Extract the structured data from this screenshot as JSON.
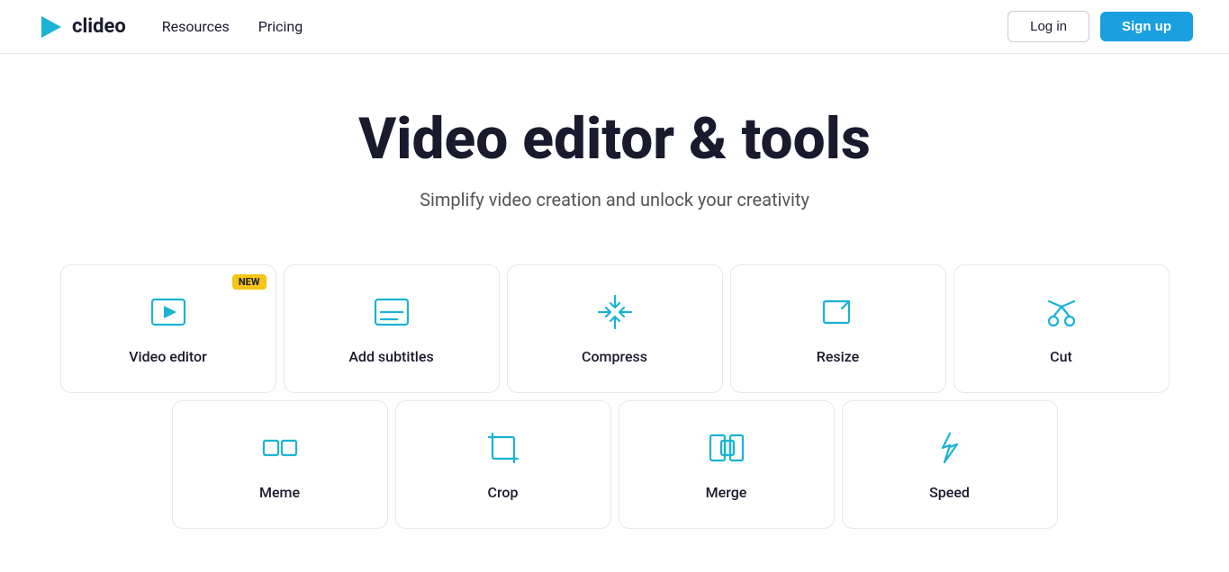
{
  "nav": {
    "logo_text": "clideo",
    "links": [
      {
        "label": "Resources",
        "id": "resources"
      },
      {
        "label": "Pricing",
        "id": "pricing"
      }
    ],
    "login_label": "Log in",
    "signup_label": "Sign up"
  },
  "hero": {
    "title": "Video editor & tools",
    "subtitle": "Simplify video creation and unlock your creativity"
  },
  "tools_row1": [
    {
      "id": "video-editor",
      "label": "Video editor",
      "icon": "video-editor-icon",
      "new": true
    },
    {
      "id": "add-subtitles",
      "label": "Add subtitles",
      "icon": "subtitles-icon",
      "new": false
    },
    {
      "id": "compress",
      "label": "Compress",
      "icon": "compress-icon",
      "new": false
    },
    {
      "id": "resize",
      "label": "Resize",
      "icon": "resize-icon",
      "new": false
    },
    {
      "id": "cut",
      "label": "Cut",
      "icon": "cut-icon",
      "new": false
    }
  ],
  "tools_row2": [
    {
      "id": "meme",
      "label": "Meme",
      "icon": "meme-icon",
      "new": false
    },
    {
      "id": "crop",
      "label": "Crop",
      "icon": "crop-icon",
      "new": false
    },
    {
      "id": "merge",
      "label": "Merge",
      "icon": "merge-icon",
      "new": false
    },
    {
      "id": "speed",
      "label": "Speed",
      "icon": "speed-icon",
      "new": false
    }
  ],
  "colors": {
    "icon_color": "#1ab3d4",
    "accent": "#1a9fe0",
    "badge_bg": "#f5c518"
  }
}
